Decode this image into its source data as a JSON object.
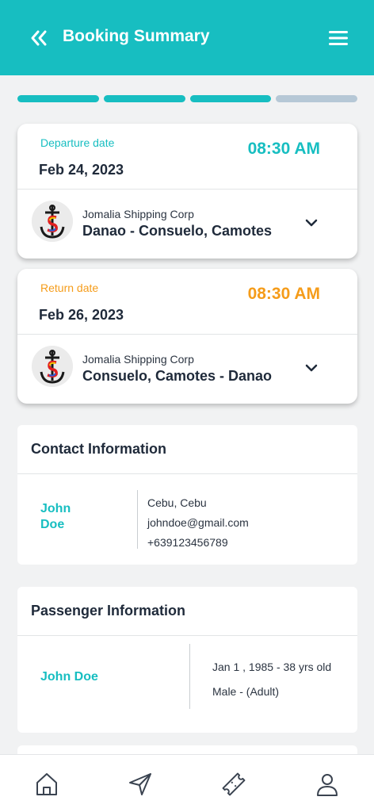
{
  "header": {
    "title": "Booking Summary"
  },
  "progress": {
    "total_steps": 4,
    "completed_steps": 3
  },
  "departure": {
    "label": "Departure date",
    "date": "Feb 24, 2023",
    "time": "08:30 AM",
    "company": "Jomalia Shipping Corp",
    "route": "Danao - Consuelo, Camotes"
  },
  "return": {
    "label": "Return date",
    "date": "Feb 26, 2023",
    "time": "08:30 AM",
    "company": "Jomalia Shipping Corp",
    "route": "Consuelo, Camotes - Danao"
  },
  "contact": {
    "title": "Contact Information",
    "first_name": "John",
    "last_name": "Doe",
    "address": "Cebu, Cebu",
    "email": "johndoe@gmail.com",
    "phone": "+639123456789"
  },
  "passenger": {
    "title": "Passenger Information",
    "name": "John Doe",
    "birth": "Jan 1 , 1985 - 38 yrs old",
    "type": "Male - (Adult)"
  },
  "colors": {
    "accent": "#17bec1",
    "return_accent": "#f59c1a",
    "inactive_step": "#b6c8d6"
  },
  "nav": {
    "items": [
      "home-icon",
      "send-icon",
      "ticket-icon",
      "profile-icon"
    ]
  }
}
